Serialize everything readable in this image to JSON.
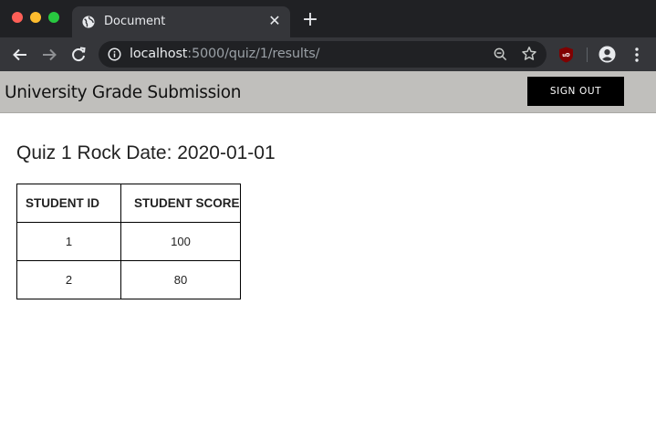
{
  "browser": {
    "tab_title": "Document",
    "url_host": "localhost",
    "url_path": ":5000/quiz/1/results/",
    "colors": {
      "chrome_dark": "#202124",
      "chrome_toolbar": "#35363a",
      "close": "#fe5f57",
      "minimize": "#febc2e",
      "maximize": "#28c840"
    }
  },
  "header": {
    "site_title": "University Grade Submission",
    "signout_label": "SIGN OUT",
    "background": "#c0bfbc"
  },
  "main": {
    "heading": "Quiz 1 Rock Date: 2020-01-01",
    "table": {
      "columns": [
        "STUDENT ID",
        "STUDENT SCORE"
      ],
      "rows": [
        [
          "1",
          "100"
        ],
        [
          "2",
          "80"
        ]
      ]
    }
  }
}
